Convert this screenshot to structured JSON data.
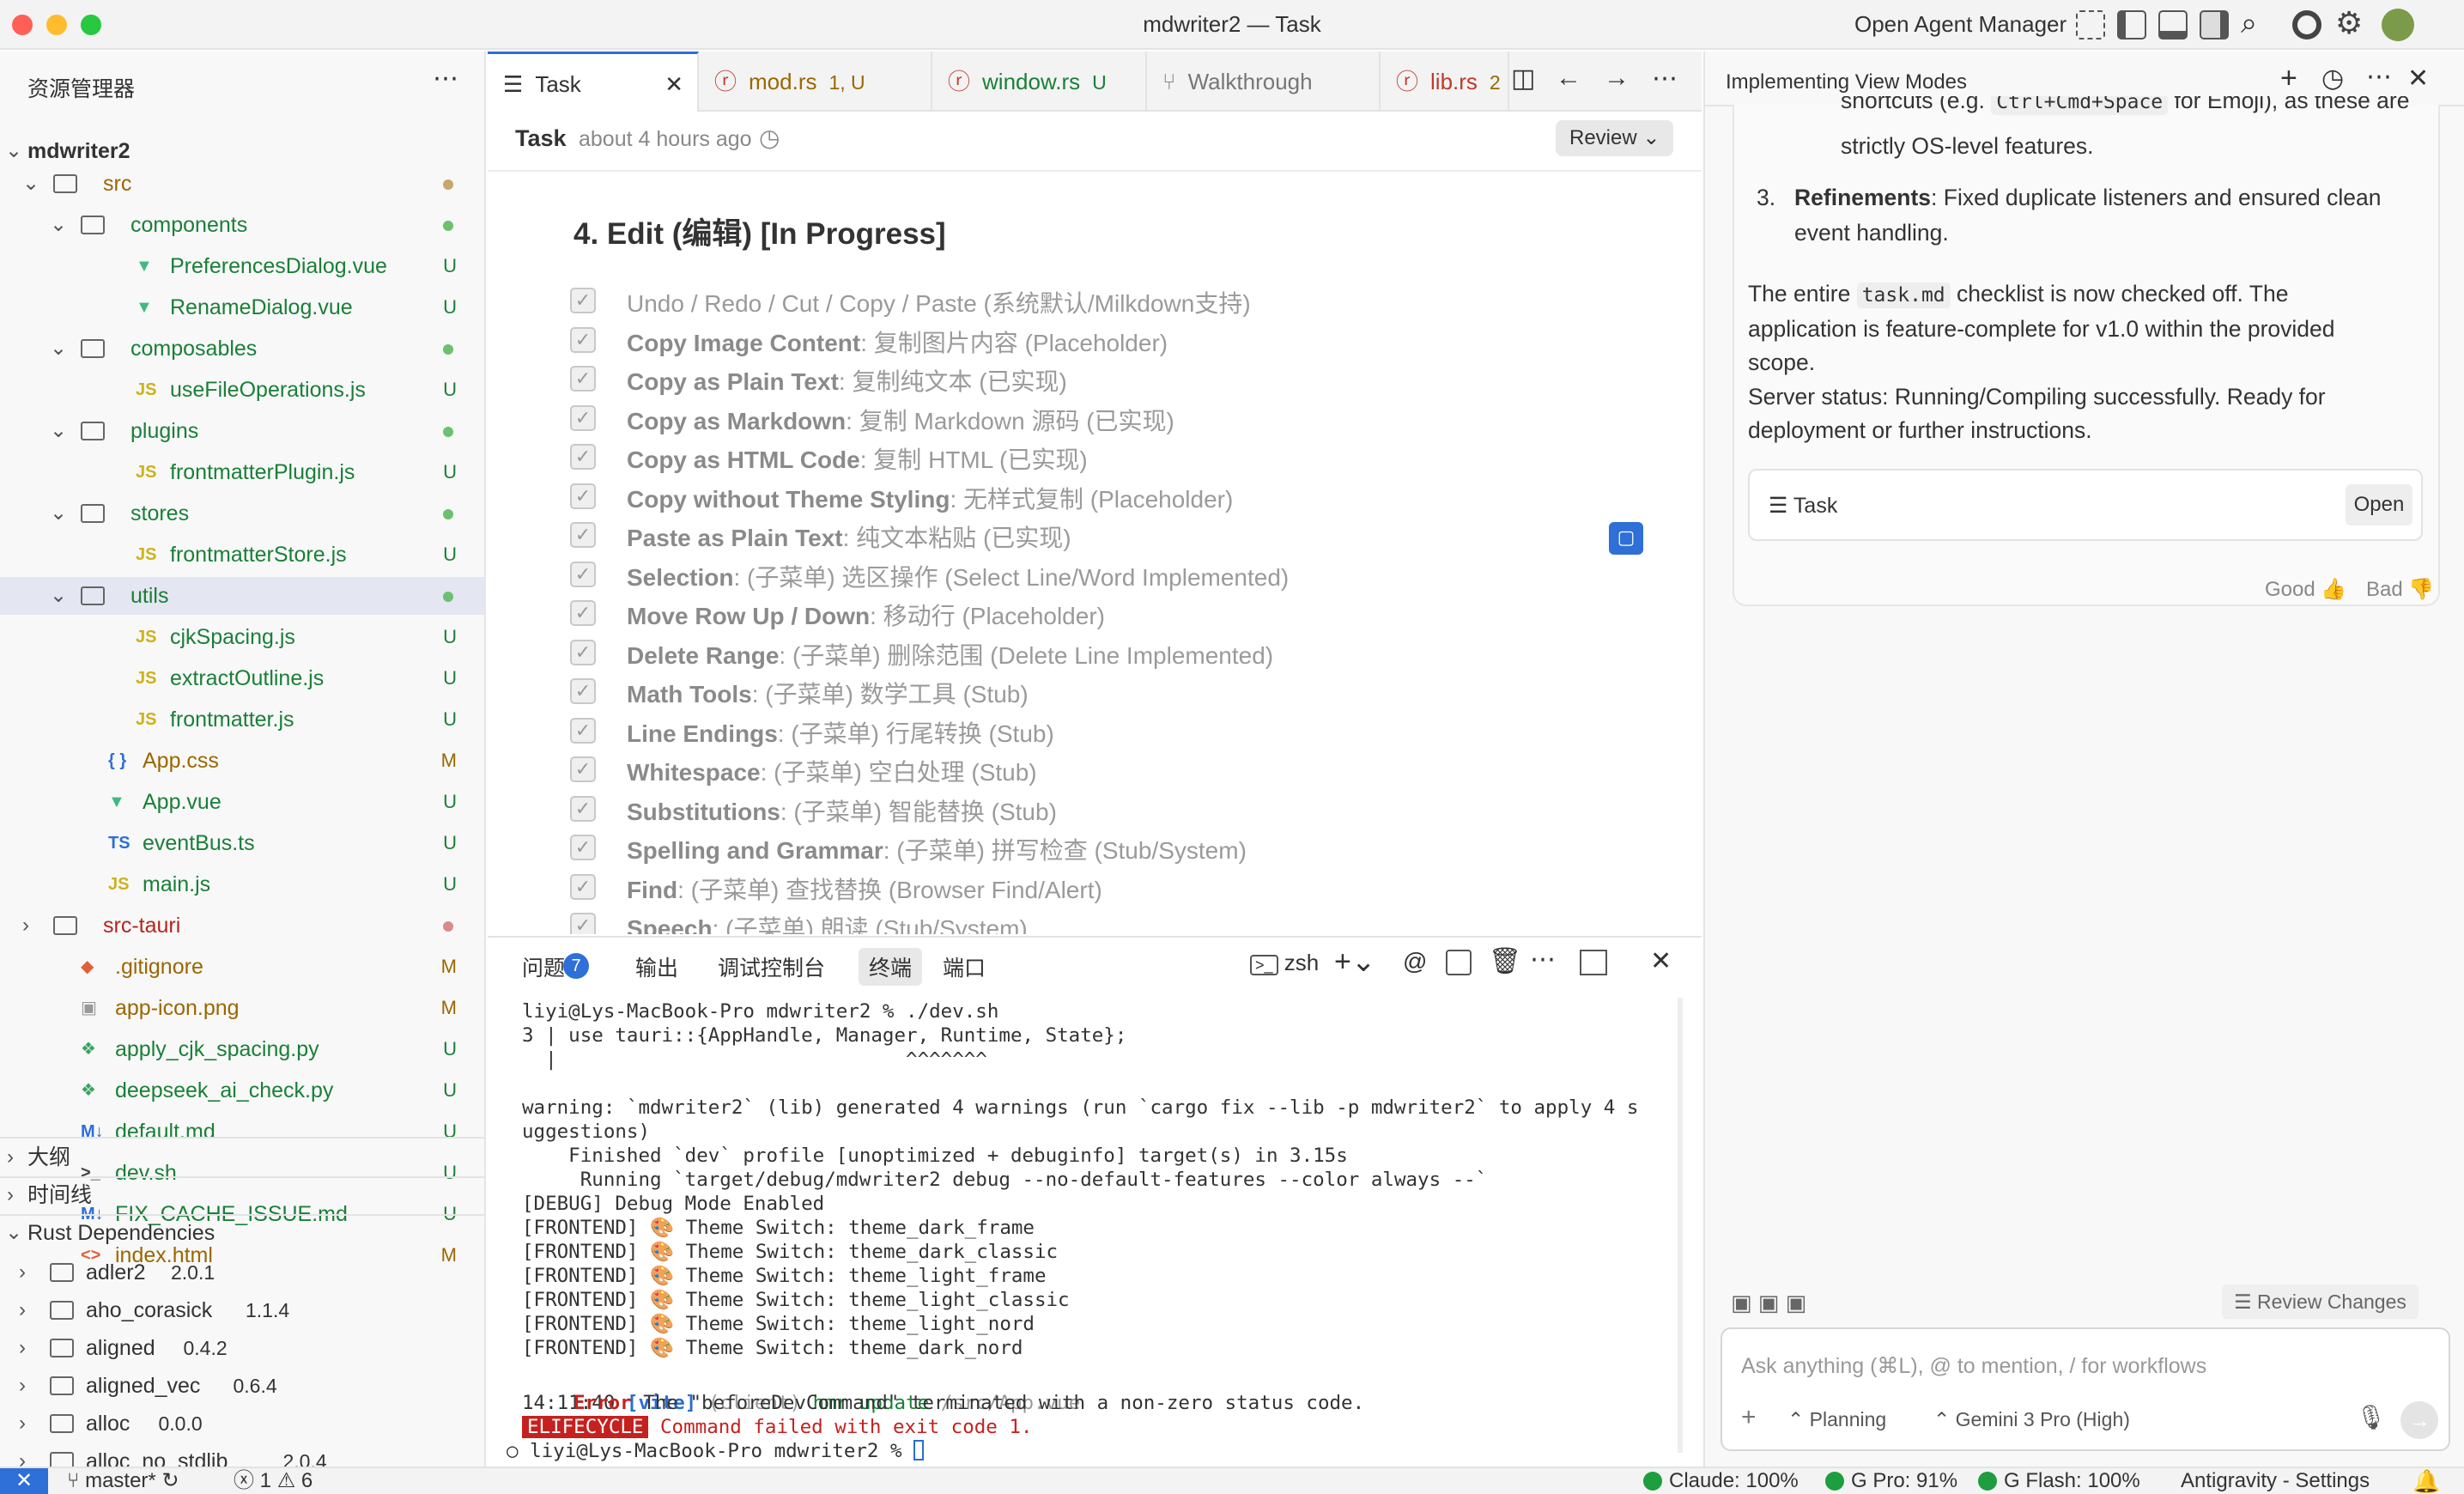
{
  "window": {
    "title": "mdwriter2 — Task",
    "agent_manager": "Open Agent Manager"
  },
  "explorer": {
    "title": "资源管理器",
    "project": "mdwriter2",
    "tree": [
      {
        "name": "src",
        "indent": 0,
        "folder": true,
        "open": true,
        "color": "o",
        "dot": "#c9a66b"
      },
      {
        "name": "components",
        "indent": 1,
        "folder": true,
        "open": true,
        "color": "g",
        "dot": "#6cc070"
      },
      {
        "name": "PreferencesDialog.vue",
        "indent": 2,
        "icon": "vue",
        "color": "g",
        "status": "U"
      },
      {
        "name": "RenameDialog.vue",
        "indent": 2,
        "icon": "vue",
        "color": "g",
        "status": "U"
      },
      {
        "name": "composables",
        "indent": 1,
        "folder": true,
        "open": true,
        "color": "g",
        "dot": "#6cc070"
      },
      {
        "name": "useFileOperations.js",
        "indent": 2,
        "icon": "js",
        "color": "g",
        "status": "U"
      },
      {
        "name": "plugins",
        "indent": 1,
        "folder": true,
        "open": true,
        "color": "g",
        "dot": "#6cc070"
      },
      {
        "name": "frontmatterPlugin.js",
        "indent": 2,
        "icon": "js",
        "color": "g",
        "status": "U"
      },
      {
        "name": "stores",
        "indent": 1,
        "folder": true,
        "open": true,
        "color": "g",
        "dot": "#6cc070"
      },
      {
        "name": "frontmatterStore.js",
        "indent": 2,
        "icon": "js",
        "color": "g",
        "status": "U"
      },
      {
        "name": "utils",
        "indent": 1,
        "folder": true,
        "open": true,
        "color": "g",
        "dot": "#6cc070",
        "selected": true
      },
      {
        "name": "cjkSpacing.js",
        "indent": 2,
        "icon": "js",
        "color": "g",
        "status": "U"
      },
      {
        "name": "extractOutline.js",
        "indent": 2,
        "icon": "js",
        "color": "g",
        "status": "U"
      },
      {
        "name": "frontmatter.js",
        "indent": 2,
        "icon": "js",
        "color": "g",
        "status": "U"
      },
      {
        "name": "App.css",
        "indent": 1,
        "icon": "css",
        "color": "o",
        "status": "M"
      },
      {
        "name": "App.vue",
        "indent": 1,
        "icon": "vue",
        "color": "g",
        "status": "U"
      },
      {
        "name": "eventBus.ts",
        "indent": 1,
        "icon": "ts",
        "color": "g",
        "status": "U"
      },
      {
        "name": "main.js",
        "indent": 1,
        "icon": "js",
        "color": "g",
        "status": "U"
      },
      {
        "name": "src-tauri",
        "indent": 0,
        "folder": true,
        "open": false,
        "color": "r",
        "dot": "#d98a8a"
      },
      {
        "name": ".gitignore",
        "indent": 0,
        "icon": "git",
        "color": "o",
        "status": "M"
      },
      {
        "name": "app-icon.png",
        "indent": 0,
        "icon": "img",
        "color": "o",
        "status": "M"
      },
      {
        "name": "apply_cjk_spacing.py",
        "indent": 0,
        "icon": "py",
        "color": "g",
        "status": "U"
      },
      {
        "name": "deepseek_ai_check.py",
        "indent": 0,
        "icon": "py",
        "color": "g",
        "status": "U"
      },
      {
        "name": "default.md",
        "indent": 0,
        "icon": "md",
        "color": "g",
        "status": "U"
      },
      {
        "name": "dev.sh",
        "indent": 0,
        "icon": "sh",
        "color": "g",
        "status": "U"
      },
      {
        "name": "FIX_CACHE_ISSUE.md",
        "indent": 0,
        "icon": "md",
        "color": "g",
        "status": "U"
      },
      {
        "name": "index.html",
        "indent": 0,
        "icon": "html",
        "color": "o",
        "status": "M"
      }
    ],
    "outline": "大纲",
    "timeline": "时间线",
    "rust_deps": "Rust Dependencies",
    "deps": [
      {
        "name": "adler2",
        "ver": "2.0.1"
      },
      {
        "name": "aho_corasick",
        "ver": "1.1.4"
      },
      {
        "name": "aligned",
        "ver": "0.4.2"
      },
      {
        "name": "aligned_vec",
        "ver": "0.6.4"
      },
      {
        "name": "alloc",
        "ver": "0.0.0"
      },
      {
        "name": "alloc_no_stdlib",
        "ver": "2.0.4"
      }
    ]
  },
  "tabs": [
    {
      "label": "Task",
      "badge": "",
      "active": true
    },
    {
      "label": "mod.rs",
      "badge": "1, U"
    },
    {
      "label": "window.rs",
      "badge": "U"
    },
    {
      "label": "Walkthrough",
      "badge": ""
    },
    {
      "label": "lib.rs",
      "badge": "2"
    }
  ],
  "task": {
    "label": "Task",
    "time": "about 4 hours ago",
    "review": "Review",
    "heading": "4. Edit (编辑) [In Progress]",
    "items": [
      {
        "b": "",
        "t": "Undo / Redo / Cut / Copy / Paste (系统默认/Milkdown支持)"
      },
      {
        "b": "Copy Image Content",
        "t": ": 复制图片内容 (Placeholder)"
      },
      {
        "b": "Copy as Plain Text",
        "t": ": 复制纯文本 (已实现)"
      },
      {
        "b": "Copy as Markdown",
        "t": ": 复制 Markdown 源码 (已实现)"
      },
      {
        "b": "Copy as HTML Code",
        "t": ": 复制 HTML (已实现)"
      },
      {
        "b": "Copy without Theme Styling",
        "t": ": 无样式复制 (Placeholder)"
      },
      {
        "b": "Paste as Plain Text",
        "t": ": 纯文本粘贴 (已实现)"
      },
      {
        "b": "Selection",
        "t": ": (子菜单) 选区操作 (Select Line/Word Implemented)"
      },
      {
        "b": "Move Row Up / Down",
        "t": ": 移动行 (Placeholder)"
      },
      {
        "b": "Delete Range",
        "t": ": (子菜单) 删除范围 (Delete Line Implemented)"
      },
      {
        "b": "Math Tools",
        "t": ": (子菜单) 数学工具 (Stub)"
      },
      {
        "b": "Line Endings",
        "t": ": (子菜单) 行尾转换 (Stub)"
      },
      {
        "b": "Whitespace",
        "t": ": (子菜单) 空白处理 (Stub)"
      },
      {
        "b": "Substitutions",
        "t": ": (子菜单) 智能替换 (Stub)"
      },
      {
        "b": "Spelling and Grammar",
        "t": ": (子菜单) 拼写检查 (Stub/System)"
      },
      {
        "b": "Find",
        "t": ": (子菜单) 查找替换 (Browser Find/Alert)"
      },
      {
        "b": "Speech",
        "t": ": (子菜单) 朗读 (Stub/System)"
      }
    ]
  },
  "panel": {
    "tabs": [
      "问题",
      "输出",
      "调试控制台",
      "终端",
      "端口"
    ],
    "problems_count": "7",
    "shell": "zsh",
    "lines": [
      "liyi@Lys-MacBook-Pro mdwriter2 % ./dev.sh",
      "3 | use tauri::{AppHandle, Manager, Runtime, State};",
      "  |                              ^^^^^^^",
      "",
      "warning: `mdwriter2` (lib) generated 4 warnings (run `cargo fix --lib -p mdwriter2` to apply 4 s",
      "uggestions)",
      "    Finished `dev` profile [unoptimized + debuginfo] target(s) in 3.15s",
      "     Running `target/debug/mdwriter2 debug --no-default-features --color always --`",
      "[DEBUG] Debug Mode Enabled",
      "[FRONTEND] 🎨 Theme Switch: theme_dark_frame",
      "[FRONTEND] 🎨 Theme Switch: theme_dark_classic",
      "[FRONTEND] 🎨 Theme Switch: theme_light_frame",
      "[FRONTEND] 🎨 Theme Switch: theme_light_classic",
      "[FRONTEND] 🎨 Theme Switch: theme_light_nord",
      "[FRONTEND] 🎨 Theme Switch: theme_dark_nord"
    ],
    "hmr_time": "14:11:40",
    "hmr_vite": "[vite]",
    "hmr_client": "(client)",
    "hmr_text": "hmr update",
    "hmr_path": "/src/App.vue",
    "err_label": "Error",
    "err_text": "The \"beforeDevCommand\" terminated with a non-zero status code.",
    "elife": "ELIFECYCLE",
    "elife_text": "Command failed with exit code 1.",
    "prompt": "liyi@Lys-MacBook-Pro mdwriter2 % "
  },
  "agent": {
    "title": "Implementing View Modes",
    "top_text1": "shortcuts (e.g.",
    "top_code": "Ctrl+Cmd+Space",
    "top_text2": "for Emoji), as these are",
    "top_text3": "strictly OS-level features.",
    "num": "3.",
    "ref_b": "Refinements",
    "ref_t1": ": Fixed duplicate listeners and ensured clean",
    "ref_t2": "event handling.",
    "p1a": "The entire",
    "p1code": "task.md",
    "p1b": "checklist is now checked off. The",
    "p1c": "application is feature-complete for v1.0 within the provided",
    "p1d": "scope.",
    "p2a": "Server status: Running/Compiling successfully. Ready for",
    "p2b": "deployment or further instructions.",
    "card_label": "Task",
    "card_open": "Open",
    "good": "Good",
    "bad": "Bad",
    "review_changes": "Review Changes",
    "placeholder": "Ask anything (⌘L), @ to mention, / for workflows",
    "planning": "Planning",
    "model": "Gemini 3 Pro (High)"
  },
  "status": {
    "branch": "master*",
    "errors": "1",
    "warnings": "6",
    "claude": "Claude: 100%",
    "gpro": "G Pro: 91%",
    "gflash": "G Flash: 100%",
    "settings": "Antigravity - Settings"
  }
}
